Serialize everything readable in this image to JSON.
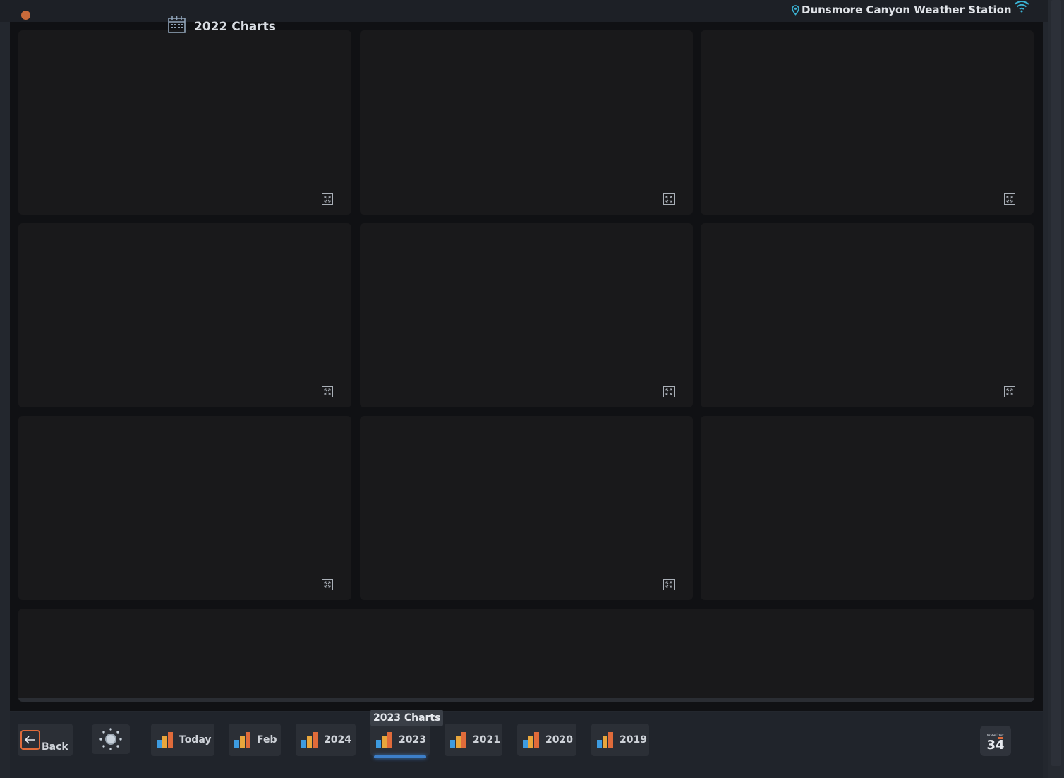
{
  "header": {
    "page_title": "2022 Charts",
    "station_name": "Dunsmore Canyon Weather Station"
  },
  "charts": {
    "panel_count": 9,
    "expand_label": "expand"
  },
  "footer": {
    "back_label": "Back",
    "buttons": [
      {
        "label": "Today"
      },
      {
        "label": "Feb"
      },
      {
        "label": "2024"
      },
      {
        "label": "2023"
      },
      {
        "label": "2021"
      },
      {
        "label": "2020"
      },
      {
        "label": "2019"
      }
    ],
    "active_button": "2023",
    "tooltip": "2023 Charts",
    "logo": {
      "small": "weather",
      "number": "34"
    }
  },
  "colors": {
    "accent_orange": "#e06b3a",
    "accent_blue": "#3d9be0",
    "active_underline": "#3d7fc9",
    "location_pin": "#3bb3d4"
  }
}
